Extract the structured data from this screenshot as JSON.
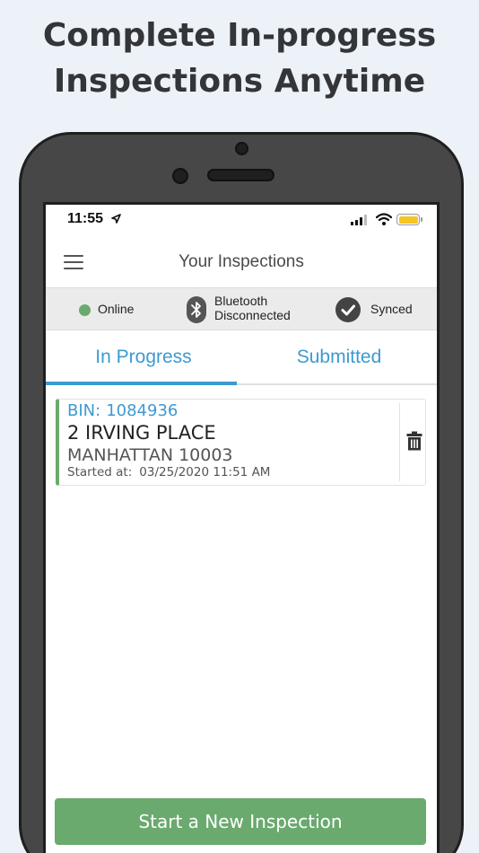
{
  "headline": {
    "line1": "Complete In-progress",
    "line2": "Inspections Anytime"
  },
  "status_bar": {
    "time": "11:55",
    "battery_color": "#f6c523"
  },
  "navbar": {
    "title": "Your Inspections",
    "menu_icon": "hamburger-menu-icon"
  },
  "connection": {
    "online_label": "Online",
    "online_color": "#6aaa6e",
    "bluetooth_line1": "Bluetooth",
    "bluetooth_line2": "Disconnected",
    "synced_label": "Synced"
  },
  "tabs": [
    {
      "label": "In Progress",
      "active": true
    },
    {
      "label": "Submitted",
      "active": false
    }
  ],
  "inspections": [
    {
      "bin_label": "BIN:",
      "bin": "1084936",
      "street": "2 IRVING PLACE",
      "borough": "MANHATTAN 10003",
      "started_label": "Started at:",
      "started_at": "03/25/2020 11:51 AM"
    }
  ],
  "actions": {
    "start_new": "Start a New Inspection"
  },
  "colors": {
    "accent": "#3d9ad1",
    "success": "#6aaa6e"
  }
}
